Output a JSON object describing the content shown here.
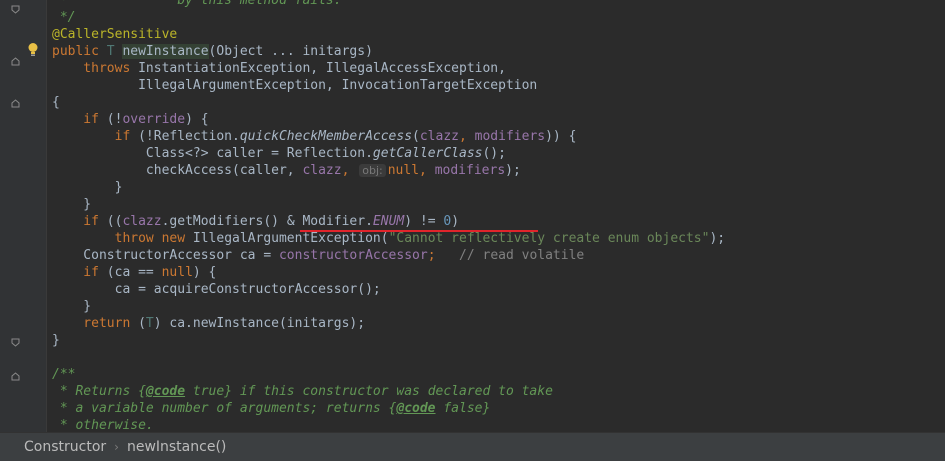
{
  "code": {
    "l0": {
      "a": " *              by this method fails."
    },
    "l1": {
      "a": " */"
    },
    "l2": {
      "a": "@CallerSensitive"
    },
    "l3": {
      "a": "public ",
      "b": "T ",
      "c": "newInstance",
      "d": "(Object ... initargs)"
    },
    "l4": {
      "a": "    throws ",
      "b": "InstantiationException, IllegalAccessException,"
    },
    "l5": {
      "a": "           IllegalArgumentException, InvocationTargetException"
    },
    "l6": {
      "a": "{"
    },
    "l7": {
      "a": "    if ",
      "b": "(!",
      "c": "override",
      "d": ") {"
    },
    "l8": {
      "a": "        if ",
      "b": "(!Reflection.",
      "c": "quickCheckMemberAccess",
      "d": "(",
      "e": "clazz",
      "f": ", ",
      "g": "modifiers",
      "h": ")) {"
    },
    "l9": {
      "a": "            Class<?> caller = Reflection.",
      "b": "getCallerClass",
      "c": "();"
    },
    "l10": {
      "a": "            checkAccess(caller, ",
      "b": "clazz",
      "c": ", ",
      "hint": "obj:",
      "d": "null",
      "e": ", ",
      "f": "modifiers",
      "g": ");"
    },
    "l11": {
      "a": "        }"
    },
    "l12": {
      "a": "    }"
    },
    "l13": {
      "a": "    if ",
      "b": "((",
      "c": "clazz",
      "d": ".getModifiers() & Modifier.",
      "e": "ENUM",
      "f": ") != ",
      "g": "0",
      "h": ")"
    },
    "l14": {
      "a": "        throw new ",
      "b": "IllegalArgumentException(",
      "c": "\"Cannot reflectively create enum objects\"",
      "d": ");"
    },
    "l15": {
      "a": "    ConstructorAccessor ca = ",
      "b": "constructorAccessor",
      "c": ";   ",
      "d": "// read volatile"
    },
    "l16": {
      "a": "    if ",
      "b": "(ca == ",
      "c": "null",
      "d": ") {"
    },
    "l17": {
      "a": "        ca = acquireConstructorAccessor();"
    },
    "l18": {
      "a": "    }"
    },
    "l19": {
      "a": "    return ",
      "b": "(",
      "c": "T",
      "d": ") ca.newInstance(initargs);"
    },
    "l20": {
      "a": "}"
    },
    "l21": {
      "a": ""
    },
    "l22": {
      "a": "/**"
    },
    "l23": {
      "a": " * Returns {",
      "b": "@code",
      "c": " true} if this constructor was declared to take"
    },
    "l24": {
      "a": " * a variable number of arguments; returns {",
      "b": "@code",
      "c": " false}"
    },
    "l25": {
      "a": " * otherwise."
    }
  },
  "breadcrumb": {
    "class_name": "Constructor",
    "separator": "›",
    "method_name": "newInstance()"
  },
  "icons": [
    "intention-bulb-icon",
    "fold-icon"
  ],
  "colors": {
    "keyword": "#cc7832",
    "annotation": "#bbb529",
    "comment": "#629755",
    "field": "#9876aa",
    "error_underline": "#e0242b"
  }
}
